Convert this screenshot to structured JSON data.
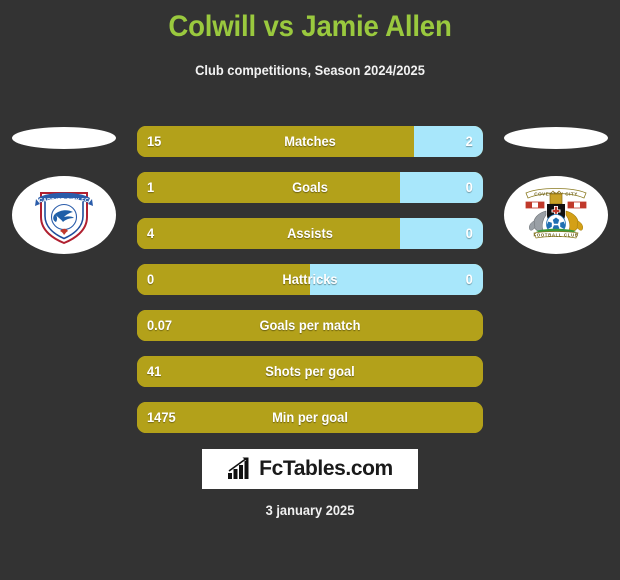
{
  "header": {
    "title": "Colwill vs Jamie Allen",
    "subtitle": "Club competitions, Season 2024/2025"
  },
  "colors": {
    "background": "#333333",
    "title": "#9ac93e",
    "home_bar": "#b3a11a",
    "away_bar": "#a8e7fb",
    "text": "#ffffff"
  },
  "teams": {
    "home": {
      "name": "Cardiff City FC",
      "badge": "cardiff-city-crest"
    },
    "away": {
      "name": "Coventry City FC",
      "badge": "coventry-city-crest"
    }
  },
  "stats": [
    {
      "label": "Matches",
      "home": "15",
      "away": "2",
      "home_pct": 80,
      "split": true
    },
    {
      "label": "Goals",
      "home": "1",
      "away": "0",
      "home_pct": 76,
      "split": true
    },
    {
      "label": "Assists",
      "home": "4",
      "away": "0",
      "home_pct": 76,
      "split": true
    },
    {
      "label": "Hattricks",
      "home": "0",
      "away": "0",
      "home_pct": 50,
      "split": true
    },
    {
      "label": "Goals per match",
      "home": "0.07",
      "away": "",
      "home_pct": 100,
      "split": false
    },
    {
      "label": "Shots per goal",
      "home": "41",
      "away": "",
      "home_pct": 100,
      "split": false
    },
    {
      "label": "Min per goal",
      "home": "1475",
      "away": "",
      "home_pct": 100,
      "split": false
    }
  ],
  "footer": {
    "logo_text": "FcTables.com",
    "logo_icon": "bar-chart-arrow-icon",
    "date": "3 january 2025"
  }
}
